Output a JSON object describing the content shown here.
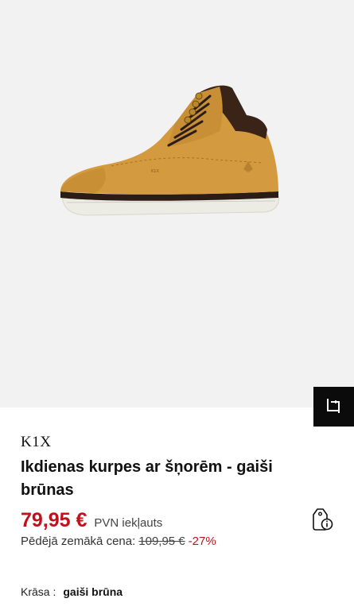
{
  "product": {
    "brand": "K1X",
    "title": "Ikdienas kurpes ar šņorēm - gaiši brūnas",
    "image_icon": "sneaker-product-photo"
  },
  "price": {
    "current": "79,95 €",
    "vat_note": "PVN iekļauts",
    "lowest_label": "Pēdējā zemākā cena:",
    "lowest_old": "109,95 €",
    "discount": "-27%",
    "accent_color": "#c1121c"
  },
  "variant": {
    "color_label": "Krāsa :",
    "color_value": "gaiši brūna"
  },
  "icons": {
    "compare": "compare-crop-icon",
    "price_info": "price-tag-info-icon"
  }
}
